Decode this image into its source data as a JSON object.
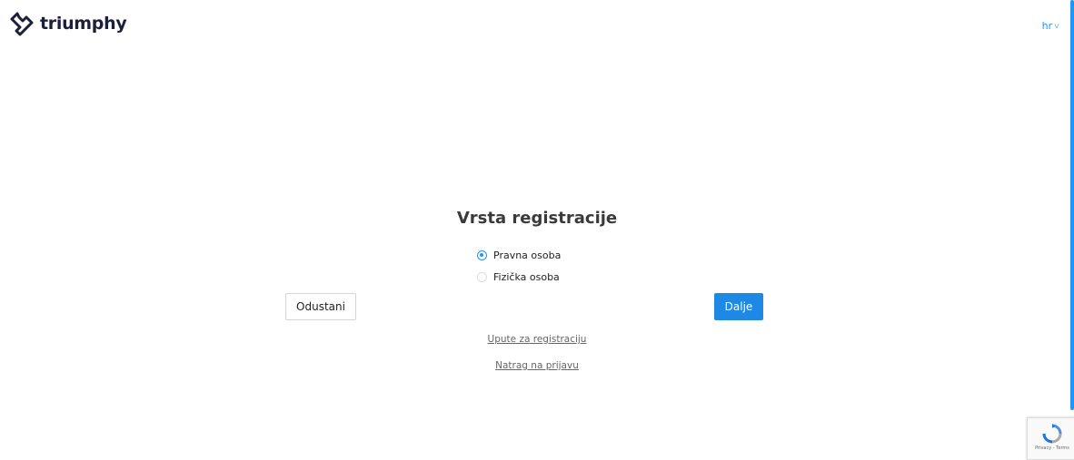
{
  "header": {
    "logo_text": "triumphy",
    "language": "hr",
    "language_chevron": "chevron-down-icon"
  },
  "main": {
    "title": "Vrsta registracije",
    "options": [
      {
        "label": "Pravna osoba",
        "selected": true
      },
      {
        "label": "Fizička osoba",
        "selected": false
      }
    ],
    "cancel_label": "Odustani",
    "next_label": "Dalje",
    "links": {
      "instructions": "Upute za registraciju",
      "back_to_login": "Natrag na prijavu"
    }
  },
  "recaptcha": {
    "footer_text": "Privacy - Terms"
  },
  "colors": {
    "accent": "#2196f3",
    "primary_button": "#1e88e5",
    "logo": "#1c1f3a"
  }
}
